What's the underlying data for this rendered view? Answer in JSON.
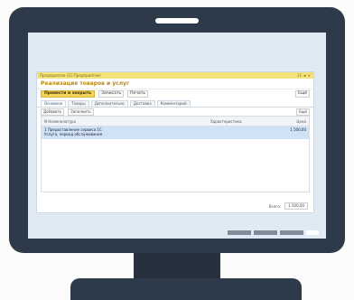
{
  "app": {
    "titlebar_left": "Предприятие (1С:Предприятие)",
    "titlebar_right": "1С ★ ✕",
    "document_title": "Реализация товаров и услуг"
  },
  "toolbar": {
    "primary_label": "Провести и закрыть",
    "save_label": "Записать",
    "print_label": "Печать",
    "more_label": "Ещё"
  },
  "tabs": [
    {
      "label": "Основное",
      "active": true
    },
    {
      "label": "Товары",
      "active": false
    },
    {
      "label": "Дополнительно",
      "active": false
    },
    {
      "label": "Доставка",
      "active": false
    },
    {
      "label": "Комментарий",
      "active": false
    }
  ],
  "subbar": {
    "add_label": "Добавить",
    "fill_label": "Заполнить",
    "more_label": "Ещё"
  },
  "grid": {
    "columns": [
      "N  Номенклатура",
      "Характеристика",
      "Цена"
    ],
    "rows": [
      {
        "line1": "1  Предоставление сервиса 1С",
        "line2": "Услуга, период обслуживания",
        "price": "1 500,00"
      }
    ]
  },
  "footer": {
    "total_label": "Всего:",
    "total_value": "1 500,00"
  },
  "colors": {
    "accent": "#f2d35b",
    "monitor": "#2c3a4a",
    "selection": "#cfe2f6"
  }
}
